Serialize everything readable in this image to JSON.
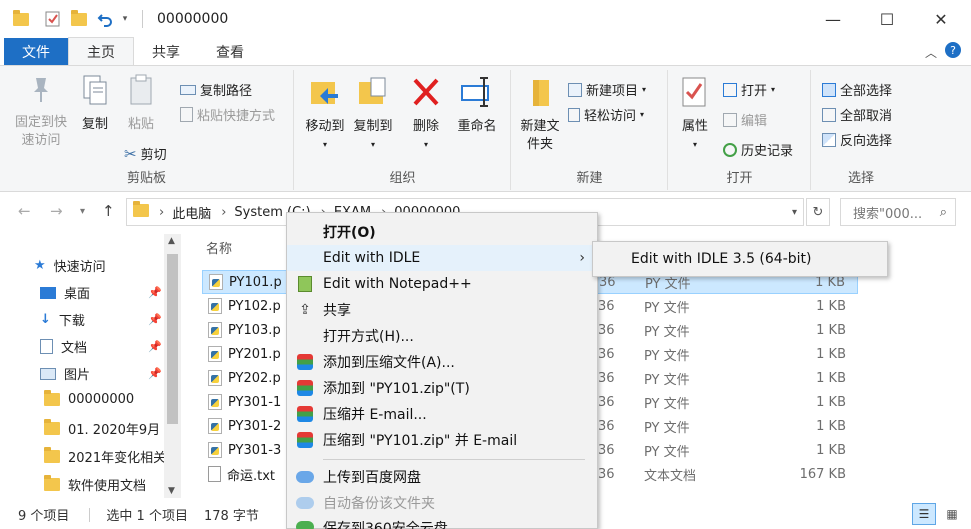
{
  "window": {
    "title": "00000000",
    "minimize_glyph": "—",
    "maximize_glyph": "☐",
    "close_glyph": "✕"
  },
  "ribbon_tabs": [
    "文件",
    "主页",
    "共享",
    "查看"
  ],
  "ribbon": {
    "clipboard": {
      "label": "剪贴板",
      "pin_quick": "固定到快速访问",
      "copy": "复制",
      "paste": "粘贴",
      "copy_path": "复制路径",
      "paste_shortcut": "粘贴快捷方式",
      "cut": "剪切"
    },
    "organize": {
      "label": "组织",
      "move_to": "移动到",
      "copy_to": "复制到",
      "delete": "删除",
      "rename": "重命名"
    },
    "new": {
      "label": "新建",
      "new_folder": "新建文件夹",
      "new_item": "新建项目",
      "easy_access": "轻松访问"
    },
    "open": {
      "label": "打开",
      "properties": "属性",
      "open": "打开",
      "edit": "编辑",
      "history": "历史记录"
    },
    "select": {
      "label": "选择",
      "select_all": "全部选择",
      "select_none": "全部取消",
      "invert": "反向选择"
    }
  },
  "address": {
    "path": [
      "此电脑",
      "System (C:)",
      "EXAM",
      "00000000"
    ],
    "search_placeholder": "搜索\"000..."
  },
  "nav_pane": {
    "quick_access": "快速访问",
    "items": [
      "桌面",
      "下载",
      "文档",
      "图片",
      "00000000",
      "01. 2020年9月",
      "2021年变化相关",
      "软件使用文档"
    ]
  },
  "list": {
    "col_name": "名称",
    "rows": [
      {
        "name": "PY101.p",
        "date": "36",
        "type": "PY 文件",
        "size": "1 KB"
      },
      {
        "name": "PY102.p",
        "date": "36",
        "type": "PY 文件",
        "size": "1 KB"
      },
      {
        "name": "PY103.p",
        "date": "36",
        "type": "PY 文件",
        "size": "1 KB"
      },
      {
        "name": "PY201.p",
        "date": "36",
        "type": "PY 文件",
        "size": "1 KB"
      },
      {
        "name": "PY202.p",
        "date": "36",
        "type": "PY 文件",
        "size": "1 KB"
      },
      {
        "name": "PY301-1",
        "date": "36",
        "type": "PY 文件",
        "size": "1 KB"
      },
      {
        "name": "PY301-2",
        "date": "36",
        "type": "PY 文件",
        "size": "1 KB"
      },
      {
        "name": "PY301-3",
        "date": "36",
        "type": "PY 文件",
        "size": "1 KB"
      },
      {
        "name": "命运.txt",
        "date": "36",
        "type": "文本文档",
        "size": "167 KB"
      }
    ]
  },
  "status": {
    "count": "9 个项目",
    "selected": "选中 1 个项目",
    "size": "178 字节"
  },
  "context_menu": {
    "items": [
      "打开(O)",
      "Edit with IDLE",
      "Edit with Notepad++",
      "共享",
      "打开方式(H)...",
      "添加到压缩文件(A)...",
      "添加到 \"PY101.zip\"(T)",
      "压缩并 E-mail...",
      "压缩到 \"PY101.zip\" 并 E-mail",
      "上传到百度网盘",
      "自动备份该文件夹",
      "保存到360安全云盘"
    ]
  },
  "submenu": {
    "item": "Edit with IDLE 3.5 (64-bit)"
  }
}
